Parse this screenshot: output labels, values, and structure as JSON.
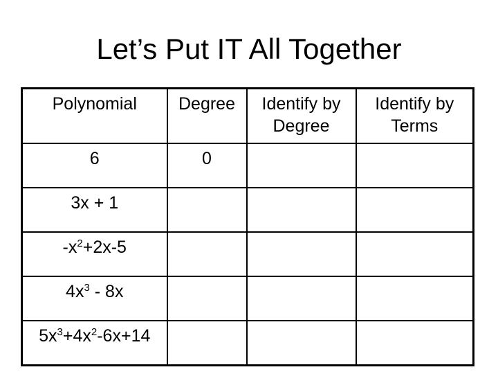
{
  "slide": {
    "title": "Let’s Put IT All Together",
    "table": {
      "headers": [
        {
          "line1": "Polynomial",
          "line2": ""
        },
        {
          "line1": "Degree",
          "line2": ""
        },
        {
          "line1": "Identify by",
          "line2": "Degree"
        },
        {
          "line1": "Identify by",
          "line2": "Terms"
        }
      ],
      "rows": [
        {
          "polynomial": "6",
          "degree": "0",
          "identify_by_degree": "",
          "identify_by_terms": ""
        },
        {
          "polynomial": "3x + 1",
          "degree": "",
          "identify_by_degree": "",
          "identify_by_terms": ""
        },
        {
          "polynomial": "-x²+2x-5",
          "degree": "",
          "identify_by_degree": "",
          "identify_by_terms": ""
        },
        {
          "polynomial": "4x³ - 8x",
          "degree": "",
          "identify_by_degree": "",
          "identify_by_terms": ""
        },
        {
          "polynomial": "5x³+4x²-6x+14",
          "degree": "",
          "identify_by_degree": "",
          "identify_by_terms": ""
        }
      ]
    }
  }
}
